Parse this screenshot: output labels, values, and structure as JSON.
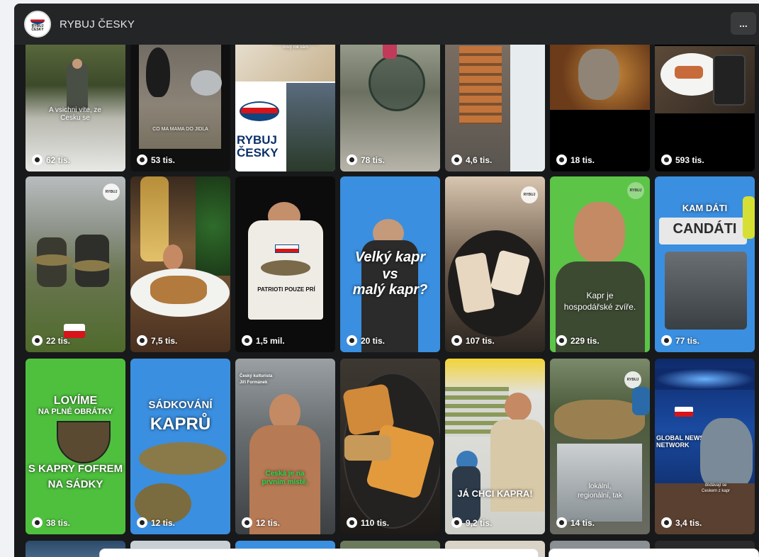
{
  "header": {
    "page_name": "RYBUJ ČESKY",
    "more_label": "...",
    "logo_text": "RYBUJ ČESKY"
  },
  "tiles": [
    {
      "views": "62 tis.",
      "caption": "A vsichni vite, ze Cesku se"
    },
    {
      "views": "53 tis.",
      "caption": "CO MA MAMA DO JIDLA"
    },
    {
      "views": "",
      "caption": "RYBUJ ČESKY",
      "top_caption": "Veselé Vánoce a šťastný nový rok vám"
    },
    {
      "views": "78 tis."
    },
    {
      "views": "4,6 tis."
    },
    {
      "views": "18 tis."
    },
    {
      "views": "593 tis."
    },
    {
      "views": "22 tis."
    },
    {
      "views": "7,5 tis."
    },
    {
      "views": "1,5 mil.",
      "caption": "PATRIOTI POUZE PRÍ"
    },
    {
      "views": "20 tis.",
      "caption_lines": [
        "Velký kapr",
        "vs",
        "malý kapr?"
      ]
    },
    {
      "views": "107 tis."
    },
    {
      "views": "229 tis.",
      "caption_lines": [
        "Kapr je",
        "hospodářské zvíře."
      ]
    },
    {
      "views": "77 tis.",
      "caption_lines": [
        "KAM DÁTI",
        "CANDÁTI"
      ]
    },
    {
      "views": "38 tis.",
      "caption_lines": [
        "LOVÍME",
        "NA PLNÉ OBRÁTKY",
        "S KAPRY FOFREM",
        "NA SÁDKY"
      ]
    },
    {
      "views": "12 tis.",
      "caption_lines": [
        "SÁDKOVÁNÍ",
        "KAPRŮ"
      ]
    },
    {
      "views": "12 tis.",
      "caption_lines": [
        "Český kulturista",
        "Jiří Formánek",
        "Ceská je na",
        "prvním místě,"
      ]
    },
    {
      "views": "110 tis."
    },
    {
      "views": "9,2 tis.",
      "caption": "JÁ CHCI KAPRA!"
    },
    {
      "views": "14 tis.",
      "caption_lines": [
        "lokální,",
        "regionální, tak"
      ]
    },
    {
      "views": "3,4 tis.",
      "caption_lines": [
        "GLOBAL NEWS",
        "NETWORK",
        "dodávají se",
        "Ceskem z kapr"
      ]
    }
  ]
}
